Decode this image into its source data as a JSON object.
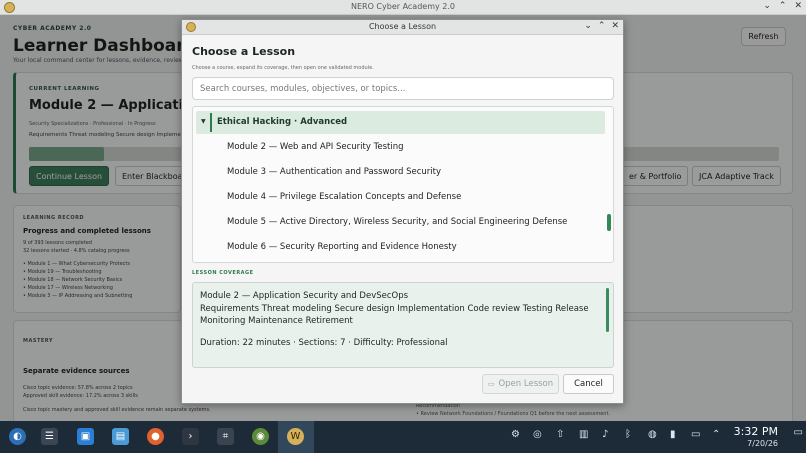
{
  "window": {
    "title": "NERO Cyber Academy 2.0"
  },
  "dashboard": {
    "brand": "CYBER ACADEMY 2.0",
    "title": "Learner Dashboard",
    "subtitle": "Your local command center for lessons, evidence, reviews, and",
    "refresh_label": "Refresh",
    "current": {
      "label": "CURRENT LEARNING",
      "module": "Module 2 — Application S",
      "meta": "Security Specializations · Professional · In Progress",
      "requirements": "Requirements Threat modeling Secure design Implements",
      "progress": 0.1,
      "continue_label": "Continue Lesson",
      "blackboard_label": "Enter Blackboar",
      "portfolio_label": "er & Portfolio",
      "jca_label": "JCA Adaptive Track"
    },
    "record": {
      "label": "LEARNING RECORD",
      "heading": "Progress and completed lessons",
      "lines": [
        "9 of 393 lessons completed",
        "32 lessons started · 4.8% catalog progress"
      ],
      "items": [
        "• Module 1 — What Cybersecurity Protects",
        "• Module 19 — Troubleshooting",
        "• Module 18 — Network Security Basics",
        "• Module 17 — Wireless Networking",
        "• Module 3 — IP Addressing and Subnetting"
      ]
    },
    "mastery": {
      "label": "MASTERY",
      "heading": "Separate evidence sources",
      "lines": [
        "Cisco topic evidence: 57.8% across 2 topics",
        "Approved skill evidence: 17.2% across 3 skills",
        "Cisco topic mastery and approved skill evidence remain separate systems."
      ],
      "rec_label": "Recommendation",
      "rec_text": "• Review Network Foundations / Foundations Q1 before the next assessment."
    }
  },
  "dialog": {
    "title": "Choose a Lesson",
    "heading": "Choose a Lesson",
    "subtitle": "Choose a course, expand its coverage, then open one validated module.",
    "search_placeholder": "Search courses, modules, objectives, or topics...",
    "group_label": "Ethical Hacking · Advanced",
    "modules": [
      "Module 2 — Web and API Security Testing",
      "Module 3 — Authentication and Password Security",
      "Module 4 — Privilege Escalation Concepts and Defense",
      "Module 5 — Active Directory, Wireless Security, and Social Engineering Defense",
      "Module 6 — Security Reporting and Evidence Honesty"
    ],
    "coverage_label": "LESSON COVERAGE",
    "coverage_title": "Module 2 — Application Security and DevSecOps",
    "coverage_topics": "Requirements Threat modeling Secure design Implementation Code review Testing Release Monitoring Maintenance Retirement",
    "coverage_details": "Duration: 22 minutes  ·  Sections: 7  ·  Difficulty: Professional",
    "open_label": "Open Lesson",
    "cancel_label": "Cancel"
  },
  "taskbar": {
    "time": "3:32 PM",
    "date": "7/20/26"
  },
  "colors": {
    "accent": "#2f7a4f",
    "taskbar": "#1d2a38"
  }
}
